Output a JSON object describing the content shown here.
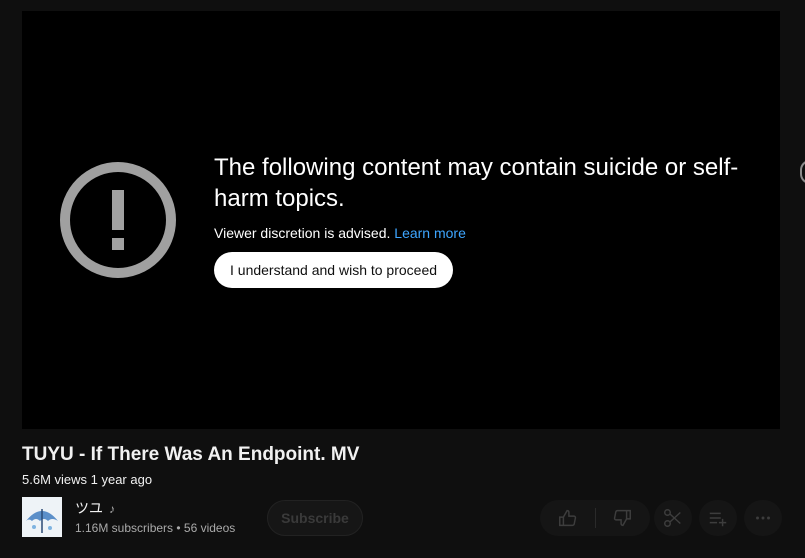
{
  "warning": {
    "title": "The following content may contain suicide or self-harm topics.",
    "subtitle": "Viewer discretion is advised.",
    "learn_more": "Learn more",
    "proceed_label": "I understand and wish to proceed",
    "icon": "exclamation-circle-icon"
  },
  "video": {
    "title": "TUYU - If There Was An Endpoint. MV",
    "meta": "5.6M views 1 year ago"
  },
  "channel": {
    "name": "ツユ",
    "badge": "♪",
    "stats": "1.16M subscribers • 56 videos",
    "subscribe_label": "Subscribe"
  },
  "actions": [
    "like-icon",
    "dislike-icon",
    "clip-icon",
    "save-to-playlist-icon",
    "more-icon"
  ],
  "colors": {
    "link": "#3ea6ff",
    "background": "#0f0f0f",
    "player": "#000000"
  }
}
